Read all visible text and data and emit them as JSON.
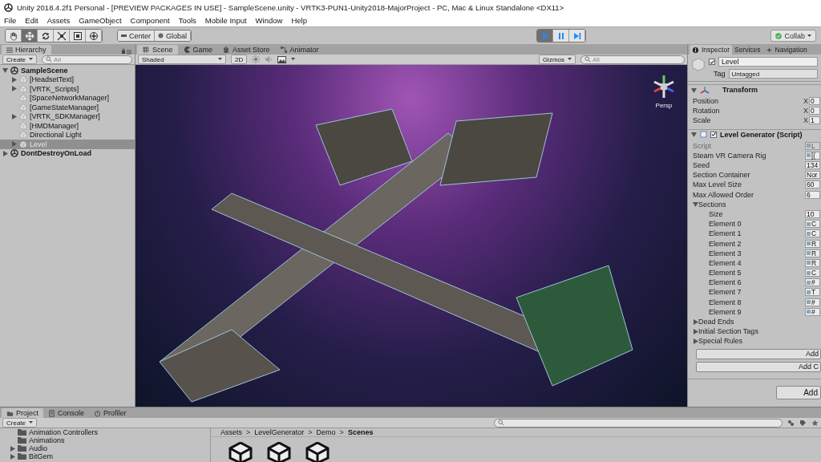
{
  "window": {
    "title": "Unity 2018.4.2f1 Personal - [PREVIEW PACKAGES IN USE] - SampleScene.unity - VRTK3-PUN1-Unity2018-MajorProject - PC, Mac & Linux Standalone <DX11>"
  },
  "menu": [
    "File",
    "Edit",
    "Assets",
    "GameObject",
    "Component",
    "Tools",
    "Mobile Input",
    "Window",
    "Help"
  ],
  "toolbar": {
    "tools": [
      {
        "kind": "hand",
        "selected": false
      },
      {
        "kind": "move",
        "selected": true
      },
      {
        "kind": "rotate",
        "selected": false
      },
      {
        "kind": "scale",
        "selected": false
      },
      {
        "kind": "rect",
        "selected": false
      },
      {
        "kind": "transform",
        "selected": false
      }
    ],
    "pivot": [
      {
        "kind": "center",
        "label": "Center"
      },
      {
        "kind": "global",
        "label": "Global"
      }
    ],
    "play_controls": [
      {
        "kind": "play",
        "selected": true
      },
      {
        "kind": "pause",
        "selected": false
      },
      {
        "kind": "step",
        "selected": false
      }
    ],
    "collab": "Collab"
  },
  "hierarchy": {
    "tab": "Hierarchy",
    "create": "Create",
    "search_placeholder": "All",
    "tree": [
      {
        "label": "SampleScene",
        "kind": "scene",
        "expandable": true,
        "expanded": true,
        "selected": false,
        "children": [
          {
            "label": "[HeadsetText]",
            "kind": "object",
            "expandable": true,
            "expanded": false,
            "selected": false
          },
          {
            "label": "[VRTK_Scripts]",
            "kind": "object",
            "expandable": true,
            "expanded": false,
            "selected": false
          },
          {
            "label": "[SpaceNetworkManager]",
            "kind": "object",
            "expandable": false,
            "selected": false
          },
          {
            "label": "[GameStateManager]",
            "kind": "object",
            "expandable": false,
            "selected": false
          },
          {
            "label": "[VRTK_SDKManager]",
            "kind": "object",
            "expandable": true,
            "expanded": false,
            "selected": false
          },
          {
            "label": "[HMDManager]",
            "kind": "object",
            "expandable": false,
            "selected": false
          },
          {
            "label": "Directional Light",
            "kind": "object",
            "expandable": false,
            "selected": false
          },
          {
            "label": "Level",
            "kind": "object",
            "expandable": true,
            "expanded": false,
            "selected": true
          }
        ]
      },
      {
        "label": "DontDestroyOnLoad",
        "kind": "scene",
        "expandable": true,
        "expanded": false,
        "selected": false
      }
    ]
  },
  "scene": {
    "tabs": [
      {
        "label": "Scene",
        "kind": "scene",
        "selected": true
      },
      {
        "label": "Game",
        "kind": "game",
        "selected": false
      },
      {
        "label": "Asset Store",
        "kind": "store",
        "selected": false
      },
      {
        "label": "Animator",
        "kind": "animator",
        "selected": false
      }
    ],
    "shading": "Shaded",
    "mode_2d": "2D",
    "gizmos": "Gizmos",
    "search_placeholder": "All",
    "view_label": "Persp"
  },
  "inspector": {
    "tabs": [
      {
        "label": "Inspector",
        "kind": "inspector",
        "selected": true
      },
      {
        "label": "Services",
        "kind": "services",
        "selected": false
      },
      {
        "label": "Navigation",
        "kind": "navigation",
        "selected": false
      }
    ],
    "object": {
      "name": "Level",
      "active": true,
      "tag_label": "Tag",
      "tag": "Untagged"
    },
    "components": [
      {
        "title": "Transform",
        "kind": "transform",
        "expanded": true,
        "rows": [
          {
            "kind": "vector",
            "label": "Position",
            "axis": "X",
            "value": "0",
            "disabled": false
          },
          {
            "kind": "vector",
            "label": "Rotation",
            "axis": "X",
            "value": "0",
            "disabled": false
          },
          {
            "kind": "vector",
            "label": "Scale",
            "axis": "X",
            "value": "1",
            "disabled": false
          }
        ]
      },
      {
        "title": "Level Generator (Script)",
        "kind": "script",
        "expanded": true,
        "enabled": true,
        "rows": [
          {
            "kind": "ref",
            "label": "Script",
            "value": "L",
            "disabled": true
          },
          {
            "kind": "ref",
            "label": "Steam VR Camera Rig",
            "value": "[(",
            "disabled": false
          },
          {
            "kind": "field",
            "label": "Seed",
            "value": "134",
            "disabled": false
          },
          {
            "kind": "field",
            "label": "Section Container",
            "value": "Nor",
            "disabled": false
          },
          {
            "kind": "field",
            "label": "Max Level Size",
            "value": "60",
            "disabled": false
          },
          {
            "kind": "field",
            "label": "Max Allowed Order",
            "value": "6",
            "disabled": false
          },
          {
            "kind": "foldout",
            "label": "Sections",
            "expanded": true,
            "children": [
              {
                "kind": "field",
                "label": "Size",
                "value": "10",
                "disabled": false
              },
              {
                "kind": "ref",
                "label": "Element 0",
                "value": "C",
                "disabled": false
              },
              {
                "kind": "ref",
                "label": "Element 1",
                "value": "C",
                "disabled": false
              },
              {
                "kind": "ref",
                "label": "Element 2",
                "value": "R",
                "disabled": false
              },
              {
                "kind": "ref",
                "label": "Element 3",
                "value": "R",
                "disabled": false
              },
              {
                "kind": "ref",
                "label": "Element 4",
                "value": "R",
                "disabled": false
              },
              {
                "kind": "ref",
                "label": "Element 5",
                "value": "C",
                "disabled": false
              },
              {
                "kind": "ref",
                "label": "Element 6",
                "value": "#",
                "disabled": false
              },
              {
                "kind": "ref",
                "label": "Element 7",
                "value": "T",
                "disabled": false
              },
              {
                "kind": "ref",
                "label": "Element 8",
                "value": "#",
                "disabled": false
              },
              {
                "kind": "ref",
                "label": "Element 9",
                "value": "#",
                "disabled": false
              }
            ]
          },
          {
            "kind": "foldout",
            "label": "Dead Ends",
            "expanded": false
          },
          {
            "kind": "foldout",
            "label": "Initial Section Tags",
            "expanded": false
          },
          {
            "kind": "foldout",
            "label": "Special Rules",
            "expanded": false
          }
        ]
      }
    ],
    "buttons": [
      "Add",
      "Add C"
    ],
    "add_component": "Add"
  },
  "project": {
    "tabs": [
      {
        "label": "Project",
        "kind": "project",
        "selected": true
      },
      {
        "label": "Console",
        "kind": "console",
        "selected": false
      },
      {
        "label": "Profiler",
        "kind": "profiler",
        "selected": false
      }
    ],
    "create": "Create",
    "folders": [
      {
        "label": "Animation Controllers",
        "expandable": false
      },
      {
        "label": "Animations",
        "expandable": false
      },
      {
        "label": "Audio",
        "expandable": true
      },
      {
        "label": "BitGem",
        "expandable": true
      }
    ],
    "breadcrumb": [
      {
        "label": "Assets",
        "current": false
      },
      {
        "separator": ">",
        "label": "LevelGenerator",
        "current": false
      },
      {
        "separator": ">",
        "label": "Demo",
        "current": false
      },
      {
        "separator": ">",
        "label": "Scenes",
        "current": true
      }
    ],
    "assets": [
      {
        "kind": "scene"
      },
      {
        "kind": "scene"
      },
      {
        "kind": "scene"
      }
    ]
  }
}
